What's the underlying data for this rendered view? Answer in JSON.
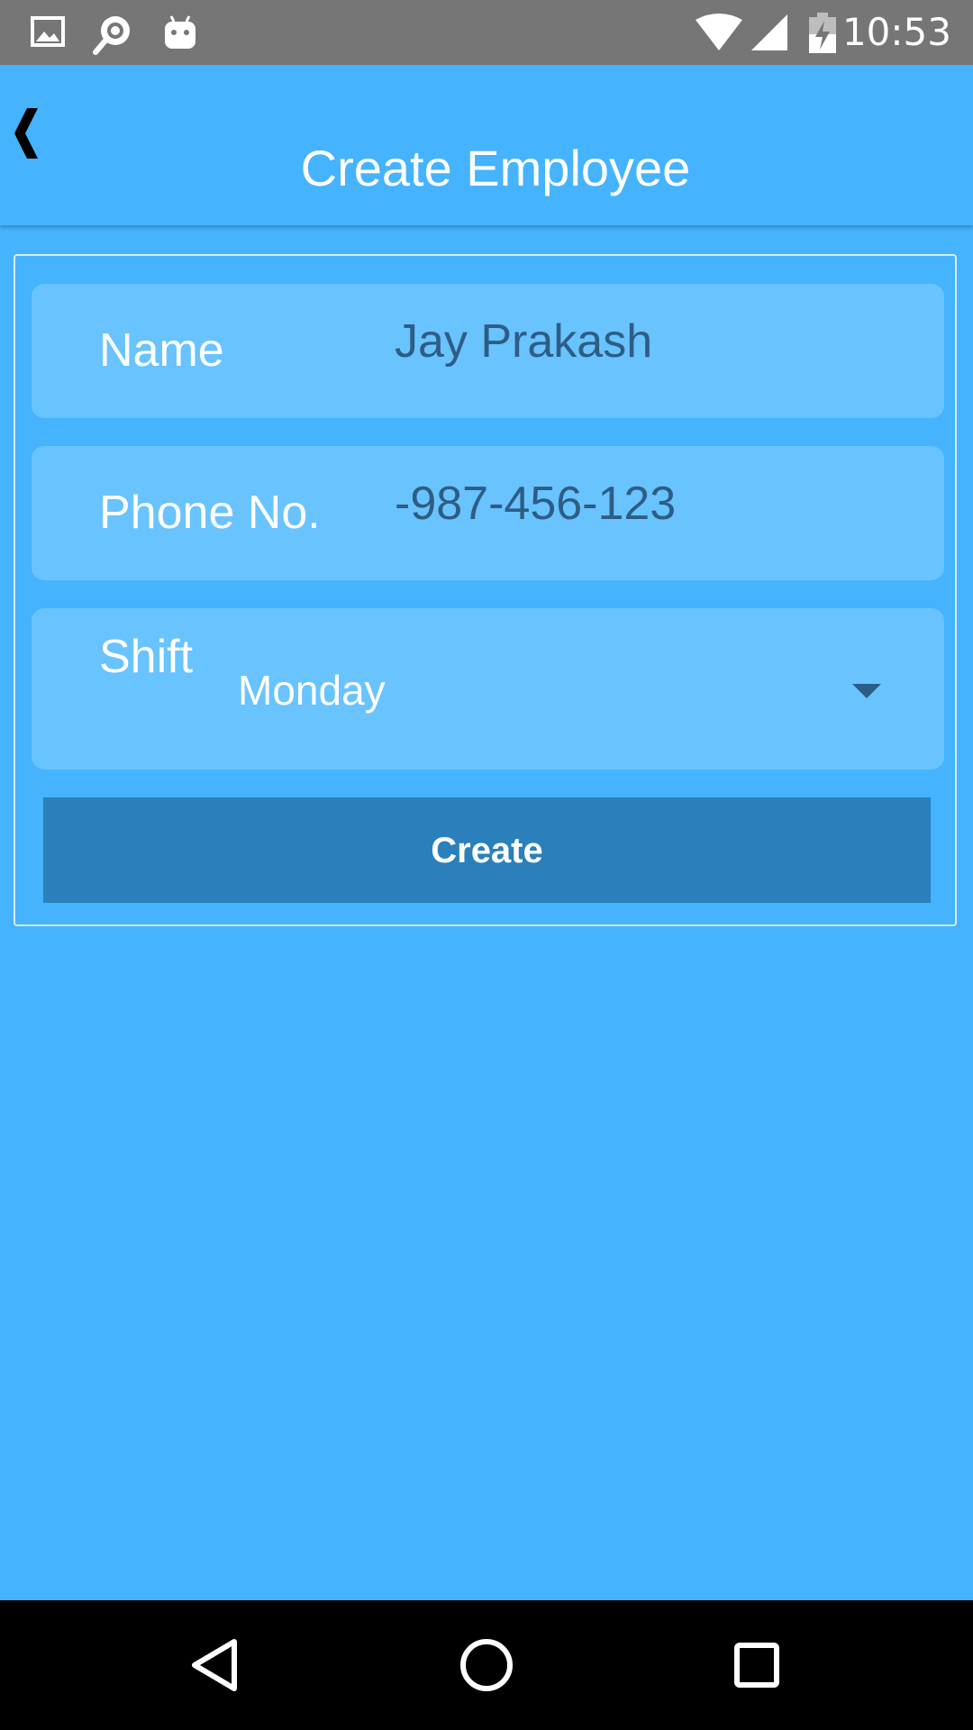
{
  "status_bar": {
    "time": "10:53",
    "icons": [
      "image-icon",
      "search-bubble-icon",
      "android-icon",
      "wifi-icon",
      "signal-icon",
      "battery-charging-icon"
    ]
  },
  "header": {
    "title": "Create Employee",
    "back_icon": "chevron-left-icon"
  },
  "form": {
    "name_label": "Name",
    "name_value": "Jay Prakash",
    "phone_label": "Phone No.",
    "phone_value": "-987-456-123",
    "shift_label": "Shift",
    "shift_selected": "Monday",
    "create_label": "Create"
  },
  "nav_bar": {
    "icons": [
      "back-triangle-icon",
      "home-circle-icon",
      "recents-square-icon"
    ]
  },
  "colors": {
    "background": "#45b3fd",
    "field_background": "#69c3fe",
    "button_background": "#2a80ba",
    "status_bar": "#767676",
    "input_text": "#2d5d85"
  }
}
